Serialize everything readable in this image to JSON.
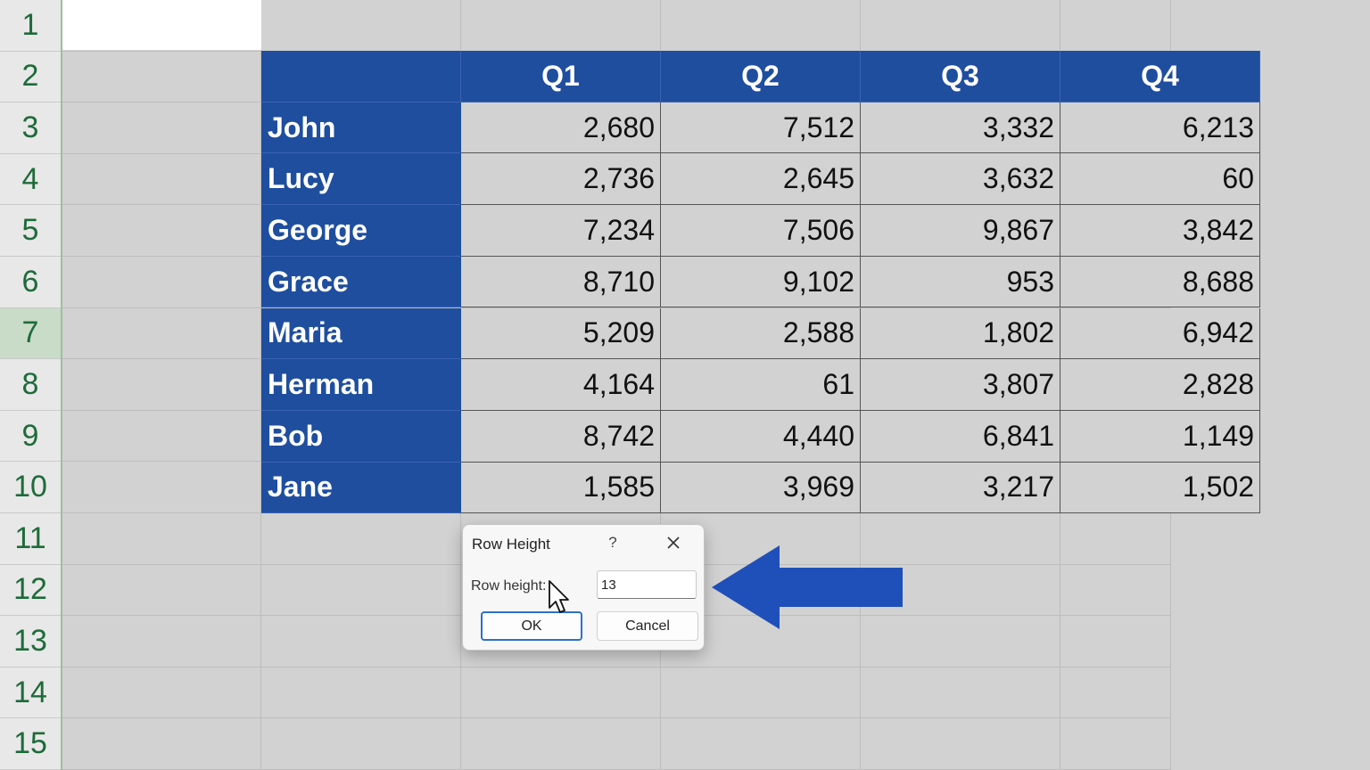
{
  "rows": [
    "1",
    "2",
    "3",
    "4",
    "5",
    "6",
    "7",
    "8",
    "9",
    "10",
    "11",
    "12",
    "13",
    "14",
    "15"
  ],
  "selected_row": "7",
  "table": {
    "headers": [
      "",
      "Q1",
      "Q2",
      "Q3",
      "Q4"
    ],
    "rows": [
      {
        "name": "John",
        "values": [
          "2,680",
          "7,512",
          "3,332",
          "6,213"
        ]
      },
      {
        "name": "Lucy",
        "values": [
          "2,736",
          "2,645",
          "3,632",
          "60"
        ]
      },
      {
        "name": "George",
        "values": [
          "7,234",
          "7,506",
          "9,867",
          "3,842"
        ]
      },
      {
        "name": "Grace",
        "values": [
          "8,710",
          "9,102",
          "953",
          "8,688"
        ]
      },
      {
        "name": "Maria",
        "values": [
          "5,209",
          "2,588",
          "1,802",
          "6,942"
        ]
      },
      {
        "name": "Herman",
        "values": [
          "4,164",
          "61",
          "3,807",
          "2,828"
        ]
      },
      {
        "name": "Bob",
        "values": [
          "8,742",
          "4,440",
          "6,841",
          "1,149"
        ]
      },
      {
        "name": "Jane",
        "values": [
          "1,585",
          "3,969",
          "3,217",
          "1,502"
        ]
      }
    ]
  },
  "dialog": {
    "title": "Row Height",
    "help": "?",
    "label": "Row height:",
    "value": "13",
    "ok_label": "OK",
    "cancel_label": "Cancel"
  },
  "colors": {
    "header_fill": "#1f4e9f",
    "arrow": "#1f4fb8",
    "row_header_text": "#1e6b3a"
  },
  "icons": {
    "close": "close-icon",
    "cursor": "mouse-pointer-icon",
    "arrow": "left-arrow-icon"
  }
}
